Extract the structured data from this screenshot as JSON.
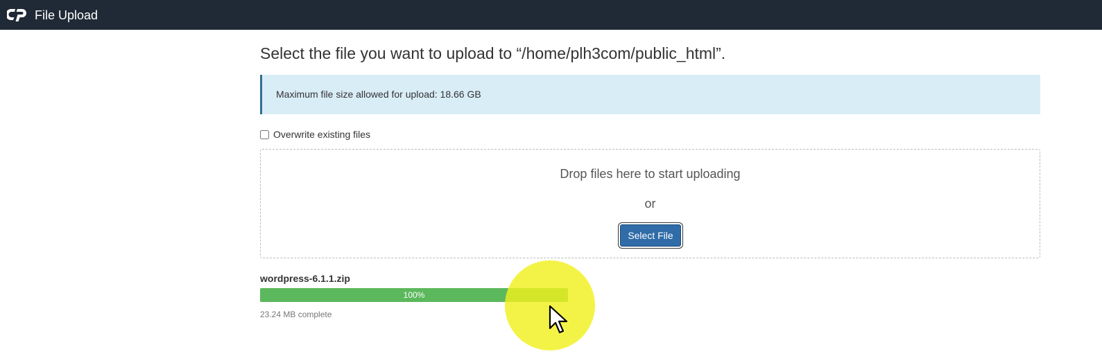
{
  "header": {
    "app_title": "File Upload",
    "logo_icon": "cpanel-logo-icon"
  },
  "main": {
    "page_title": "Select the file you want to upload to “/home/plh3com/public_html”.",
    "info_message": "Maximum file size allowed for upload: 18.66 GB",
    "overwrite_label": "Overwrite existing files",
    "overwrite_checked": false,
    "dropzone": {
      "drop_text": "Drop files here to start uploading",
      "or_text": "or",
      "select_button_label": "Select File"
    },
    "uploads": [
      {
        "file_name": "wordpress-6.1.1.zip",
        "progress_percent": 100,
        "progress_label": "100%",
        "status_text": "23.24 MB complete"
      }
    ]
  },
  "colors": {
    "topbar": "#202a36",
    "info_bg": "#d9edf7",
    "info_border": "#31708f",
    "button": "#2f6ca8",
    "progress": "#5cb85c",
    "cursor_highlight": "#f0f01e"
  }
}
